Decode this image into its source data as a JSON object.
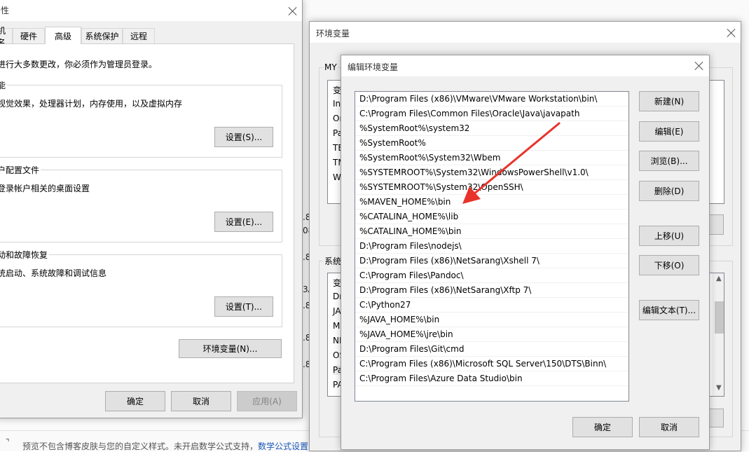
{
  "sysprops": {
    "title": "性",
    "tabs": [
      "机名",
      "硬件",
      "高级",
      "系统保护",
      "远程"
    ],
    "admin_note": "进行大多数更改，你必须作为管理员登录。",
    "perf": {
      "title": "能",
      "desc": "视觉效果，处理器计划，内存使用，以及虚拟内存",
      "button": "设置(S)..."
    },
    "profile": {
      "title": "户配置文件",
      "desc": "登录帐户相关的桌面设置",
      "button": "设置(E)..."
    },
    "startup": {
      "title": "动和故障恢复",
      "desc": "统启动、系统故障和调试信息",
      "button": "设置(T)..."
    },
    "env_button": "环境变量(N)...",
    "ok": "确定",
    "cancel": "取消",
    "apply": "应用(A)"
  },
  "envvars": {
    "title": "环境变量",
    "user_group": "MY",
    "user_items": [
      "变",
      "In",
      "Oı",
      "Pa",
      "TE",
      "TM",
      "W"
    ],
    "sys_group": "系统",
    "sys_items": [
      "变",
      "Dr",
      "JA",
      "M",
      "NI",
      "OS",
      "Pa",
      "PA"
    ]
  },
  "edit": {
    "title": "编辑环境变量",
    "paths": [
      "D:\\Program Files (x86)\\VMware\\VMware Workstation\\bin\\",
      "C:\\Program Files\\Common Files\\Oracle\\Java\\javapath",
      "%SystemRoot%\\system32",
      "%SystemRoot%",
      "%SystemRoot%\\System32\\Wbem",
      "%SYSTEMROOT%\\System32\\WindowsPowerShell\\v1.0\\",
      "%SYSTEMROOT%\\System32\\OpenSSH\\",
      "%MAVEN_HOME%\\bin",
      "%CATALINA_HOME%\\lib",
      "%CATALINA_HOME%\\bin",
      "D:\\Program Files\\nodejs\\",
      "D:\\Program Files (x86)\\NetSarang\\Xshell 7\\",
      "C:\\Program Files\\Pandoc\\",
      "D:\\Program Files (x86)\\NetSarang\\Xftp 7\\",
      "C:\\Python27",
      "%JAVA_HOME%\\bin",
      "%JAVA_HOME%\\jre\\bin",
      "D:\\Program Files\\Git\\cmd",
      "C:\\Program Files (x86)\\Microsoft SQL Server\\150\\DTS\\Binn\\",
      "C:\\Program Files\\Azure Data Studio\\bin"
    ],
    "buttons": {
      "new": "新建(N)",
      "edit": "编辑(E)",
      "browse": "浏览(B)...",
      "delete": "删除(D)",
      "up": "上移(U)",
      "down": "下移(O)",
      "edit_text": "编辑文本(T)..."
    },
    "ok": "确定",
    "cancel": "取消"
  },
  "background": {
    "frags": [
      ".8",
      "08",
      ".8",
      "3A",
      ".8",
      ".8",
      ".8"
    ],
    "bottom_text": "预览不包含博客皮肤与您的自定义样式。未开启数学公式支持，",
    "bottom_link": "数学公式设置",
    "colors": {
      "link": "#1a56b8",
      "arrow": "#e8332a"
    }
  }
}
